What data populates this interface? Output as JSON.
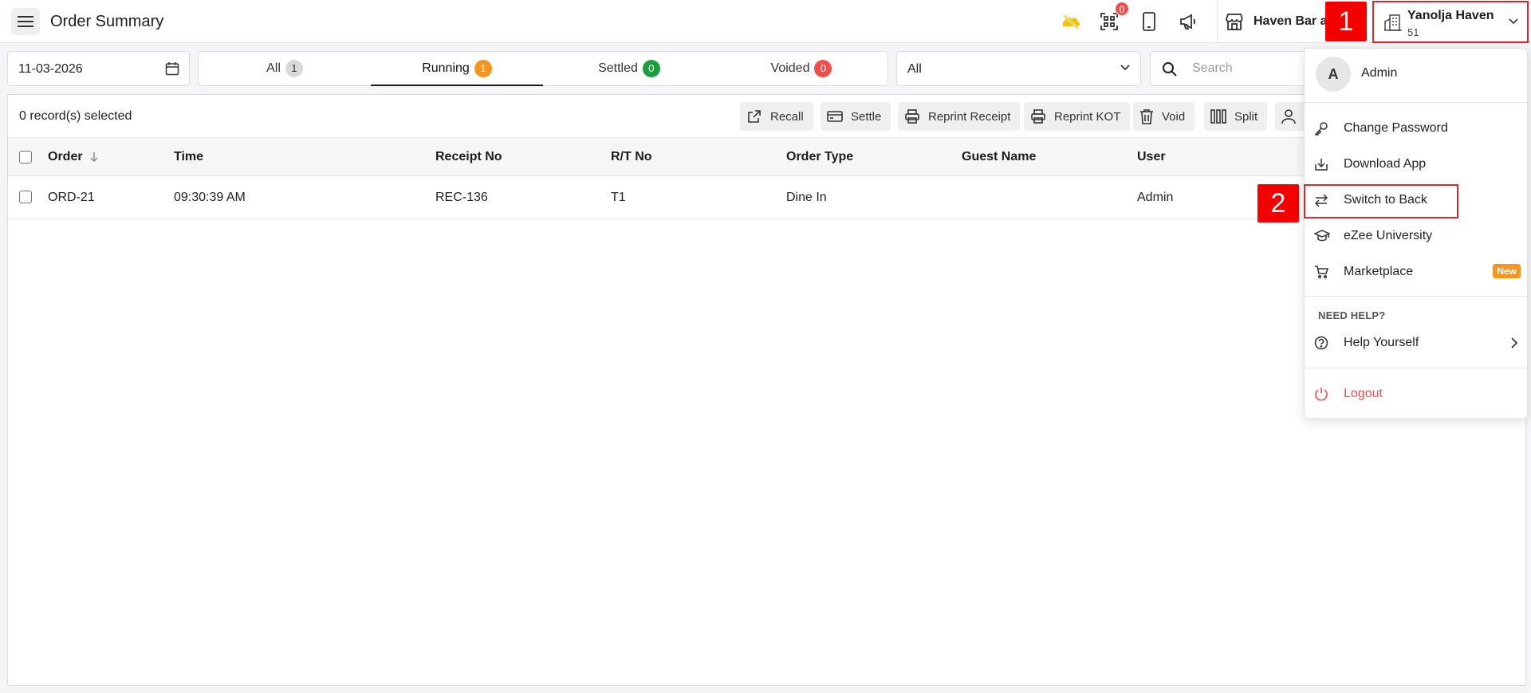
{
  "header": {
    "title": "Order Summary",
    "qr_count": "0",
    "outlet_name": "Haven Bar an",
    "property_name": "Yanolja Haven",
    "property_number": "51"
  },
  "annotations": {
    "step1": "1",
    "step2": "2"
  },
  "filters": {
    "date": "11-03-2026",
    "tabs": [
      {
        "label": "All",
        "count": "1"
      },
      {
        "label": "Running",
        "count": "1"
      },
      {
        "label": "Settled",
        "count": "0"
      },
      {
        "label": "Voided",
        "count": "0"
      }
    ],
    "active_tab": "Running",
    "order_type_selected": "All",
    "search_placeholder": "Search"
  },
  "actions": {
    "selected_text": "0 record(s) selected",
    "buttons": [
      "Recall",
      "Settle",
      "Reprint Receipt",
      "Reprint KOT",
      "Void",
      "Split"
    ]
  },
  "table": {
    "columns": [
      "Order",
      "Time",
      "Receipt No",
      "R/T No",
      "Order Type",
      "Guest Name",
      "User"
    ],
    "rows": [
      {
        "order": "ORD-21",
        "time": "09:30:39 AM",
        "receipt": "REC-136",
        "rt": "T1",
        "type": "Dine In",
        "guest": "",
        "user": "Admin"
      }
    ]
  },
  "user_menu": {
    "avatar_letter": "A",
    "user_name": "Admin",
    "items": [
      "Change Password",
      "Download App",
      "Switch to Back",
      "eZee University",
      "Marketplace"
    ],
    "new_badge": "New",
    "help_header": "NEED HELP?",
    "help_item": "Help Yourself",
    "logout": "Logout"
  },
  "colors": {
    "accent_red": "#e0262c",
    "running_orange": "#f7941d",
    "settled_green": "#1a9e3f",
    "voided_red": "#f04d4d",
    "logout_red": "#f04d4d"
  }
}
